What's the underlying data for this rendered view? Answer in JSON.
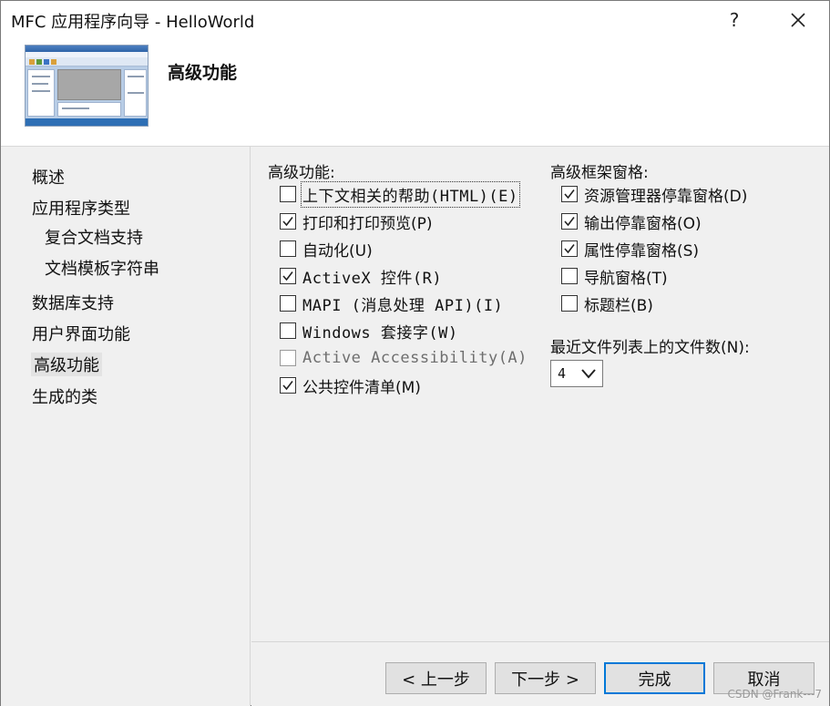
{
  "window": {
    "title": "MFC 应用程序向导 - HelloWorld",
    "help_label": "?"
  },
  "header": {
    "title": "高级功能"
  },
  "nav": {
    "items": [
      {
        "label": "概述"
      },
      {
        "label": "应用程序类型"
      },
      {
        "label": "复合文档支持"
      },
      {
        "label": "文档模板字符串"
      },
      {
        "label": "数据库支持"
      },
      {
        "label": "用户界面功能"
      },
      {
        "label": "高级功能",
        "active": true
      },
      {
        "label": "生成的类"
      }
    ]
  },
  "advanced": {
    "label": "高级功能:",
    "options": [
      {
        "label": "上下文相关的帮助(HTML)(E)",
        "checked": false,
        "disabled": false
      },
      {
        "label": "打印和打印预览(P)",
        "checked": true,
        "disabled": false
      },
      {
        "label": "自动化(U)",
        "checked": false,
        "disabled": false
      },
      {
        "label": "ActiveX 控件(R)",
        "checked": true,
        "disabled": false
      },
      {
        "label": "MAPI (消息处理 API)(I)",
        "checked": false,
        "disabled": false
      },
      {
        "label": "Windows 套接字(W)",
        "checked": false,
        "disabled": false
      },
      {
        "label": "Active Accessibility(A)",
        "checked": false,
        "disabled": true
      },
      {
        "label": "公共控件清单(M)",
        "checked": true,
        "disabled": false
      }
    ]
  },
  "frame_panes": {
    "label": "高级框架窗格:",
    "options": [
      {
        "label": "资源管理器停靠窗格(D)",
        "checked": true
      },
      {
        "label": "输出停靠窗格(O)",
        "checked": true
      },
      {
        "label": "属性停靠窗格(S)",
        "checked": true
      },
      {
        "label": "导航窗格(T)",
        "checked": false
      },
      {
        "label": "标题栏(B)",
        "checked": false
      }
    ]
  },
  "recent_files": {
    "label": "最近文件列表上的文件数(N):",
    "value": "4"
  },
  "buttons": {
    "back": "< 上一步",
    "next": "下一步 >",
    "finish": "完成",
    "cancel": "取消"
  },
  "watermark": "CSDN @Frank---7",
  "colors": {
    "accent": "#0078d7",
    "status_bar_thumb": "#2e6fb5"
  }
}
